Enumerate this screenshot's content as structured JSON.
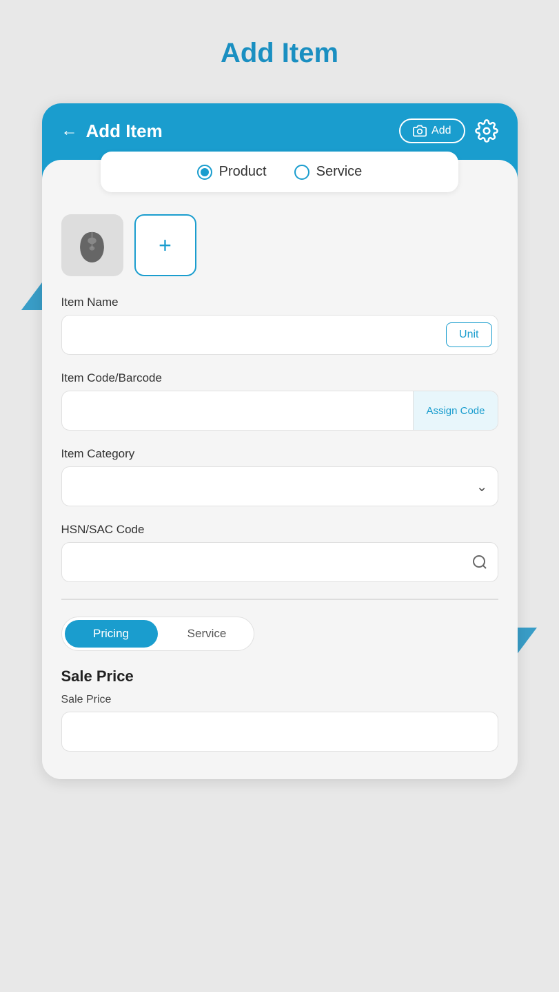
{
  "page": {
    "title": "Add Item"
  },
  "header": {
    "title": "Add Item",
    "back_label": "←",
    "add_button_label": "Add",
    "gear_label": "Settings"
  },
  "type_selector": {
    "product_label": "Product",
    "service_label": "Service",
    "selected": "product"
  },
  "form": {
    "item_name_label": "Item Name",
    "item_name_placeholder": "",
    "unit_button_label": "Unit",
    "item_code_label": "Item Code/Barcode",
    "item_code_placeholder": "",
    "assign_code_label": "Assign Code",
    "item_category_label": "Item Category",
    "hsn_sac_label": "HSN/SAC Code",
    "hsn_sac_placeholder": ""
  },
  "bottom_tabs": {
    "pricing_label": "Pricing",
    "service_label": "Service",
    "active": "pricing"
  },
  "sale_price_section": {
    "title": "Sale Price",
    "label": "Sale Price"
  }
}
